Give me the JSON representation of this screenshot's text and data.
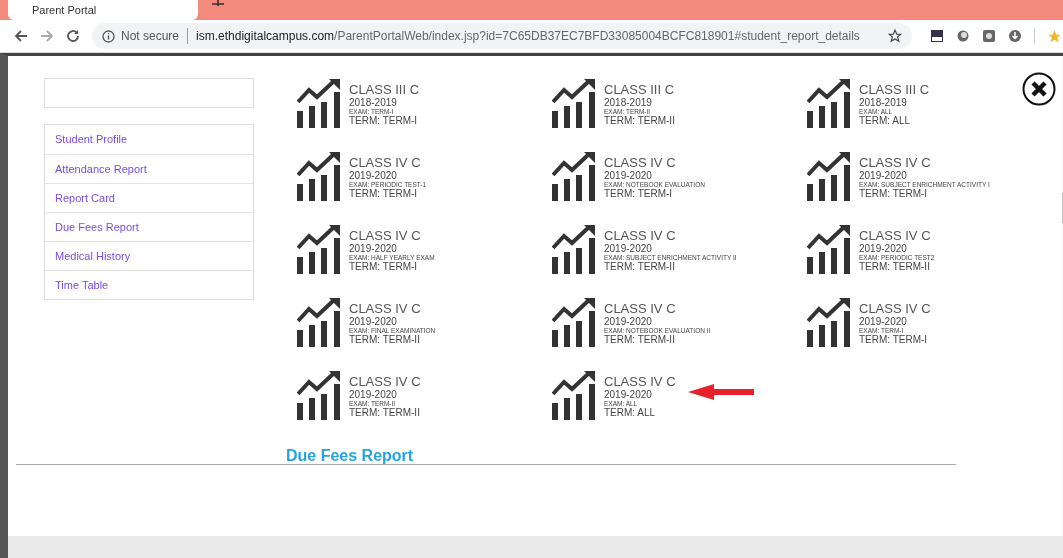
{
  "browser": {
    "tab_title": "Parent Portal",
    "security": "Not secure",
    "url_host": "ism.ethdigitalcampus.com",
    "url_path": "/ParentPortalWeb/index.jsp?id=7C65DB37EC7BFD33085004BCFC818901#student_report_details"
  },
  "sidebar": {
    "items": [
      {
        "label": "Student Profile"
      },
      {
        "label": "Attendance Report"
      },
      {
        "label": "Report Card"
      },
      {
        "label": "Due Fees Report"
      },
      {
        "label": "Medical History"
      },
      {
        "label": "Time Table"
      }
    ]
  },
  "reports": [
    {
      "class": "CLASS III C",
      "year": "2018-2019",
      "exam": "EXAM: TERM-I",
      "term": "TERM: TERM-I",
      "highlighted": false
    },
    {
      "class": "CLASS III C",
      "year": "2018-2019",
      "exam": "EXAM: TERM-II",
      "term": "TERM: TERM-II",
      "highlighted": false
    },
    {
      "class": "CLASS III C",
      "year": "2018-2019",
      "exam": "EXAM: ALL",
      "term": "TERM: ALL",
      "highlighted": false
    },
    {
      "class": "CLASS IV C",
      "year": "2019-2020",
      "exam": "EXAM: PERIODIC TEST-1",
      "term": "TERM: TERM-I",
      "highlighted": false
    },
    {
      "class": "CLASS IV C",
      "year": "2019-2020",
      "exam": "EXAM: NOTEBOOK EVALUATION",
      "term": "TERM: TERM-I",
      "highlighted": false
    },
    {
      "class": "CLASS IV C",
      "year": "2019-2020",
      "exam": "EXAM: SUBJECT ENRICHMENT ACTIVITY I",
      "term": "TERM: TERM-I",
      "highlighted": false
    },
    {
      "class": "CLASS IV C",
      "year": "2019-2020",
      "exam": "EXAM: HALF YEARLY EXAM",
      "term": "TERM: TERM-I",
      "highlighted": false
    },
    {
      "class": "CLASS IV C",
      "year": "2019-2020",
      "exam": "EXAM: SUBJECT ENRICHMENT ACTIVITY II",
      "term": "TERM: TERM-II",
      "highlighted": false
    },
    {
      "class": "CLASS IV C",
      "year": "2019-2020",
      "exam": "EXAM: PERIODIC TEST2",
      "term": "TERM: TERM-II",
      "highlighted": false
    },
    {
      "class": "CLASS IV C",
      "year": "2019-2020",
      "exam": "EXAM: FINAL EXAMINATION",
      "term": "TERM: TERM-II",
      "highlighted": false
    },
    {
      "class": "CLASS IV C",
      "year": "2019-2020",
      "exam": "EXAM: NOTEBOOK EVALUATION II",
      "term": "TERM: TERM-II",
      "highlighted": false
    },
    {
      "class": "CLASS IV C",
      "year": "2019-2020",
      "exam": "EXAM: TERM-I",
      "term": "TERM: TERM-I",
      "highlighted": false
    },
    {
      "class": "CLASS IV C",
      "year": "2019-2020",
      "exam": "EXAM: TERM-II",
      "term": "TERM: TERM-II",
      "highlighted": false
    },
    {
      "class": "CLASS IV C",
      "year": "2019-2020",
      "exam": "EXAM: ALL",
      "term": "TERM: ALL",
      "highlighted": true
    }
  ],
  "section_heading": "Due Fees Report"
}
